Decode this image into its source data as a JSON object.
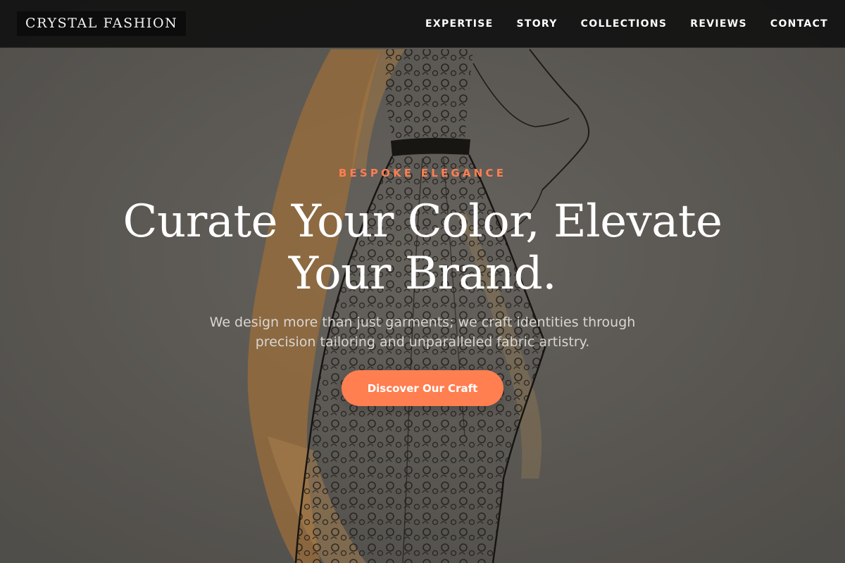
{
  "brand": {
    "logo_text": "CRYSTAL FASHION"
  },
  "nav": {
    "items": [
      {
        "label": "EXPERTISE"
      },
      {
        "label": "STORY"
      },
      {
        "label": "COLLECTIONS"
      },
      {
        "label": "REVIEWS"
      },
      {
        "label": "CONTACT"
      }
    ]
  },
  "hero": {
    "eyebrow": "BESPOKE ELEGANCE",
    "headline_line1": "Curate Your Color, Elevate",
    "headline_line2": "Your Brand.",
    "subtext_line1": "We design more than just garments; we craft identities through",
    "subtext_line2": "precision tailoring and unparalleled fabric artistry.",
    "cta_label": "Discover Our Craft",
    "background_image": "fashion-sketch-dress-illustration"
  },
  "colors": {
    "accent": "#ff7f50",
    "navbar_bg": "#121212",
    "text_light": "#ffffff"
  }
}
